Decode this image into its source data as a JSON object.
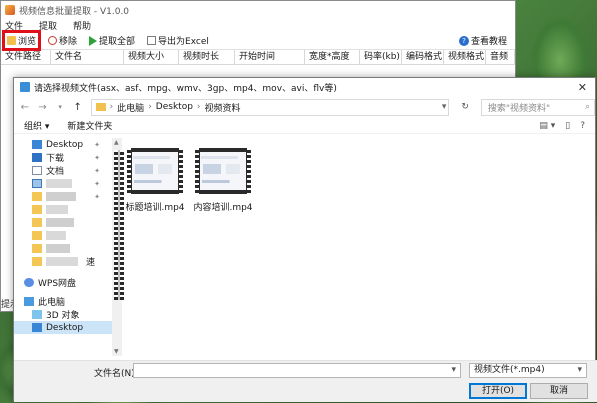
{
  "app": {
    "title": "视频信息批量提取 - V1.0.0",
    "menu": [
      "文件",
      "提取",
      "帮助"
    ],
    "toolbar": {
      "browse": "浏览",
      "remove": "移除",
      "extract_all": "提取全部",
      "export_excel": "导出为Excel",
      "help": "查看教程"
    },
    "columns": [
      "文件路径",
      "文件名",
      "视频大小",
      "视频时长",
      "开始时间",
      "宽度*高度",
      "码率(kb)",
      "编码格式",
      "视频格式",
      "音频"
    ],
    "status_partial": "提示"
  },
  "dialog": {
    "title": "请选择视频文件(asx、asf、mpg、wmv、3gp、mp4、mov、avi、flv等)",
    "close": "✕",
    "breadcrumb": [
      "此电脑",
      "Desktop",
      "视频资料"
    ],
    "search_placeholder": "搜索\"视频资料\"",
    "organize": "组织 ▾",
    "new_folder": "新建文件夹",
    "sidebar": [
      {
        "label": "Desktop",
        "icon": "desktop-icon"
      },
      {
        "label": "下载",
        "icon": "download-icon"
      },
      {
        "label": "文档",
        "icon": "document-icon"
      },
      {
        "label": "WPS网盘",
        "icon": "cloud-icon"
      },
      {
        "label": "此电脑",
        "icon": "pc-icon"
      },
      {
        "label": "3D 对象",
        "icon": "3d-objects-icon"
      },
      {
        "label": "Desktop",
        "icon": "desktop-icon"
      }
    ],
    "sidebar_partial": "速",
    "files": [
      {
        "name": "标题培训.mp4"
      },
      {
        "name": "内容培训.mp4"
      }
    ],
    "filename_label": "文件名(N):",
    "filename_value": "",
    "filetype": "视频文件(*.mp4)",
    "open_button": "打开(O)",
    "cancel_button": "取消"
  }
}
